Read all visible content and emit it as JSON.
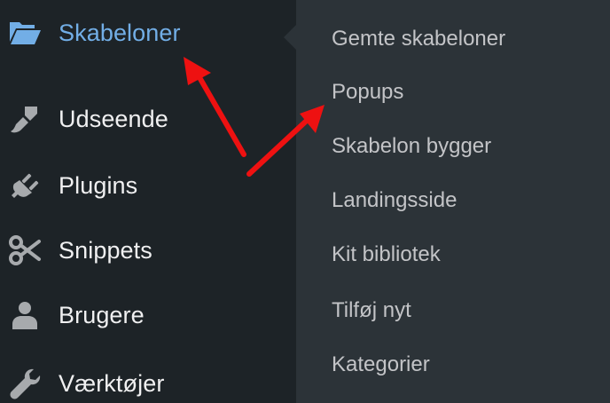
{
  "sidebar": {
    "items": [
      {
        "label": "Skabeloner",
        "icon": "folder-open-icon",
        "active": true
      },
      {
        "label": "Udseende",
        "icon": "paintbrush-icon",
        "active": false
      },
      {
        "label": "Plugins",
        "icon": "plugin-icon",
        "active": false
      },
      {
        "label": "Snippets",
        "icon": "scissors-icon",
        "active": false
      },
      {
        "label": "Brugere",
        "icon": "user-icon",
        "active": false
      },
      {
        "label": "Værktøjer",
        "icon": "wrench-icon",
        "active": false
      }
    ]
  },
  "submenu": {
    "items": [
      {
        "label": "Gemte skabeloner"
      },
      {
        "label": "Popups"
      },
      {
        "label": "Skabelon bygger"
      },
      {
        "label": "Landingsside"
      },
      {
        "label": "Kit bibliotek"
      },
      {
        "label": "Tilføj nyt"
      },
      {
        "label": "Kategorier"
      }
    ]
  },
  "colors": {
    "sidebar_bg": "#1d2327",
    "submenu_bg": "#2c3338",
    "active_text": "#72aee6",
    "menu_text": "#f0f0f1",
    "submenu_text": "#c3c4c7",
    "icon_color": "#a7aaad",
    "annotation_arrow": "#ee1111"
  }
}
